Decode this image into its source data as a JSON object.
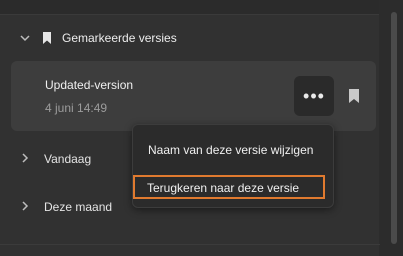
{
  "section": {
    "title": "Gemarkeerde versies",
    "chevron_icon": "chevron-down-icon",
    "bookmark_icon": "bookmark-icon"
  },
  "version_item": {
    "name": "Updated-version",
    "date": "4 juni 14:49",
    "more_label": "•••",
    "bookmark_icon": "bookmark-icon"
  },
  "groups": [
    {
      "label": "Vandaag",
      "chevron_icon": "chevron-right-icon"
    },
    {
      "label": "Deze maand",
      "chevron_icon": "chevron-right-icon"
    }
  ],
  "context_menu": {
    "items": [
      {
        "label": "Naam van deze versie wijzigen"
      },
      {
        "label": "Terugkeren naar deze versie",
        "highlighted": true
      }
    ]
  },
  "colors": {
    "background": "#313131",
    "card": "#3d3d3d",
    "menu": "#2b2b2b",
    "highlight_border": "#e07a2f",
    "text_primary": "#f0f0f0",
    "text_secondary": "#9c9c9c"
  }
}
